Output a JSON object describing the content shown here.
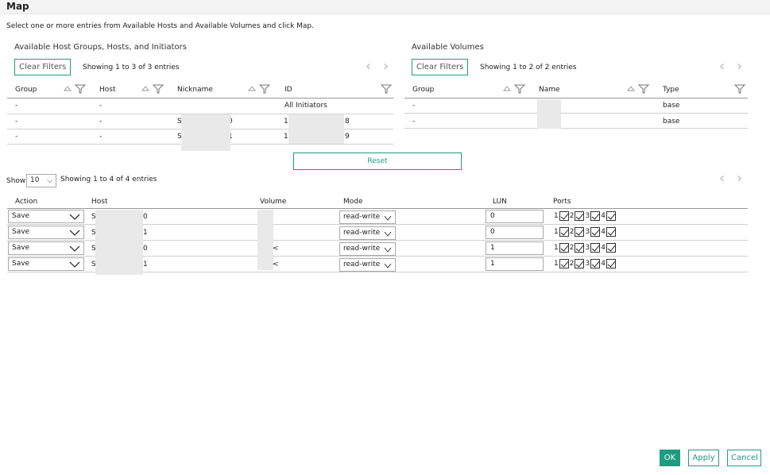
{
  "dialog": {
    "title": "Map",
    "instructions": "Select one or more entries from Available Hosts and Available Volumes and click Map."
  },
  "hosts_panel": {
    "title": "Available Host Groups, Hosts, and Initiators",
    "clear_filters": "Clear Filters",
    "showing": "Showing 1 to 3 of 3 entries",
    "columns": [
      "Group",
      "Host",
      "Nickname",
      "ID"
    ],
    "rows": [
      {
        "group": "-",
        "host": "-",
        "nickname": "",
        "id": "All Initiators"
      },
      {
        "group": "-",
        "host": "-",
        "nickname_pre": "S",
        "nickname_post": "0",
        "id_pre": "1(",
        "id_post": "8"
      },
      {
        "group": "-",
        "host": "-",
        "nickname_pre": "S",
        "nickname_post": "1",
        "id_pre": "1(",
        "id_post": "9"
      }
    ]
  },
  "volumes_panel": {
    "title": "Available Volumes",
    "clear_filters": "Clear Filters",
    "showing": "Showing 1 to 2 of 2 entries",
    "columns": [
      "Group",
      "Name",
      "Type"
    ],
    "rows": [
      {
        "group": "-",
        "type": "base"
      },
      {
        "group": "-",
        "type": "base"
      }
    ]
  },
  "reset_label": "Reset",
  "mapping": {
    "show_label": "Show",
    "page_size": "10",
    "showing": "Showing 1 to 4 of 4 entries",
    "columns": [
      "Action",
      "Host",
      "Volume",
      "Mode",
      "LUN",
      "Ports"
    ],
    "rows": [
      {
        "action": "Save",
        "host_pre": "S",
        "host_post": "0",
        "volume_post": "",
        "mode": "read-write",
        "lun": "0",
        "ports": [
          "1",
          "2",
          "3",
          "4"
        ]
      },
      {
        "action": "Save",
        "host_pre": "S",
        "host_post": "1",
        "volume_post": "",
        "mode": "read-write",
        "lun": "0",
        "ports": [
          "1",
          "2",
          "3",
          "4"
        ]
      },
      {
        "action": "Save",
        "host_pre": "S",
        "host_post": "0",
        "volume_post": "<",
        "mode": "read-write",
        "lun": "1",
        "ports": [
          "1",
          "2",
          "3",
          "4"
        ]
      },
      {
        "action": "Save",
        "host_pre": "S",
        "host_post": "1",
        "volume_post": "<",
        "mode": "read-write",
        "lun": "1",
        "ports": [
          "1",
          "2",
          "3",
          "4"
        ]
      }
    ]
  },
  "footer": {
    "ok": "OK",
    "apply": "Apply",
    "cancel": "Cancel"
  },
  "colors": {
    "accent": "#1f9c80"
  }
}
